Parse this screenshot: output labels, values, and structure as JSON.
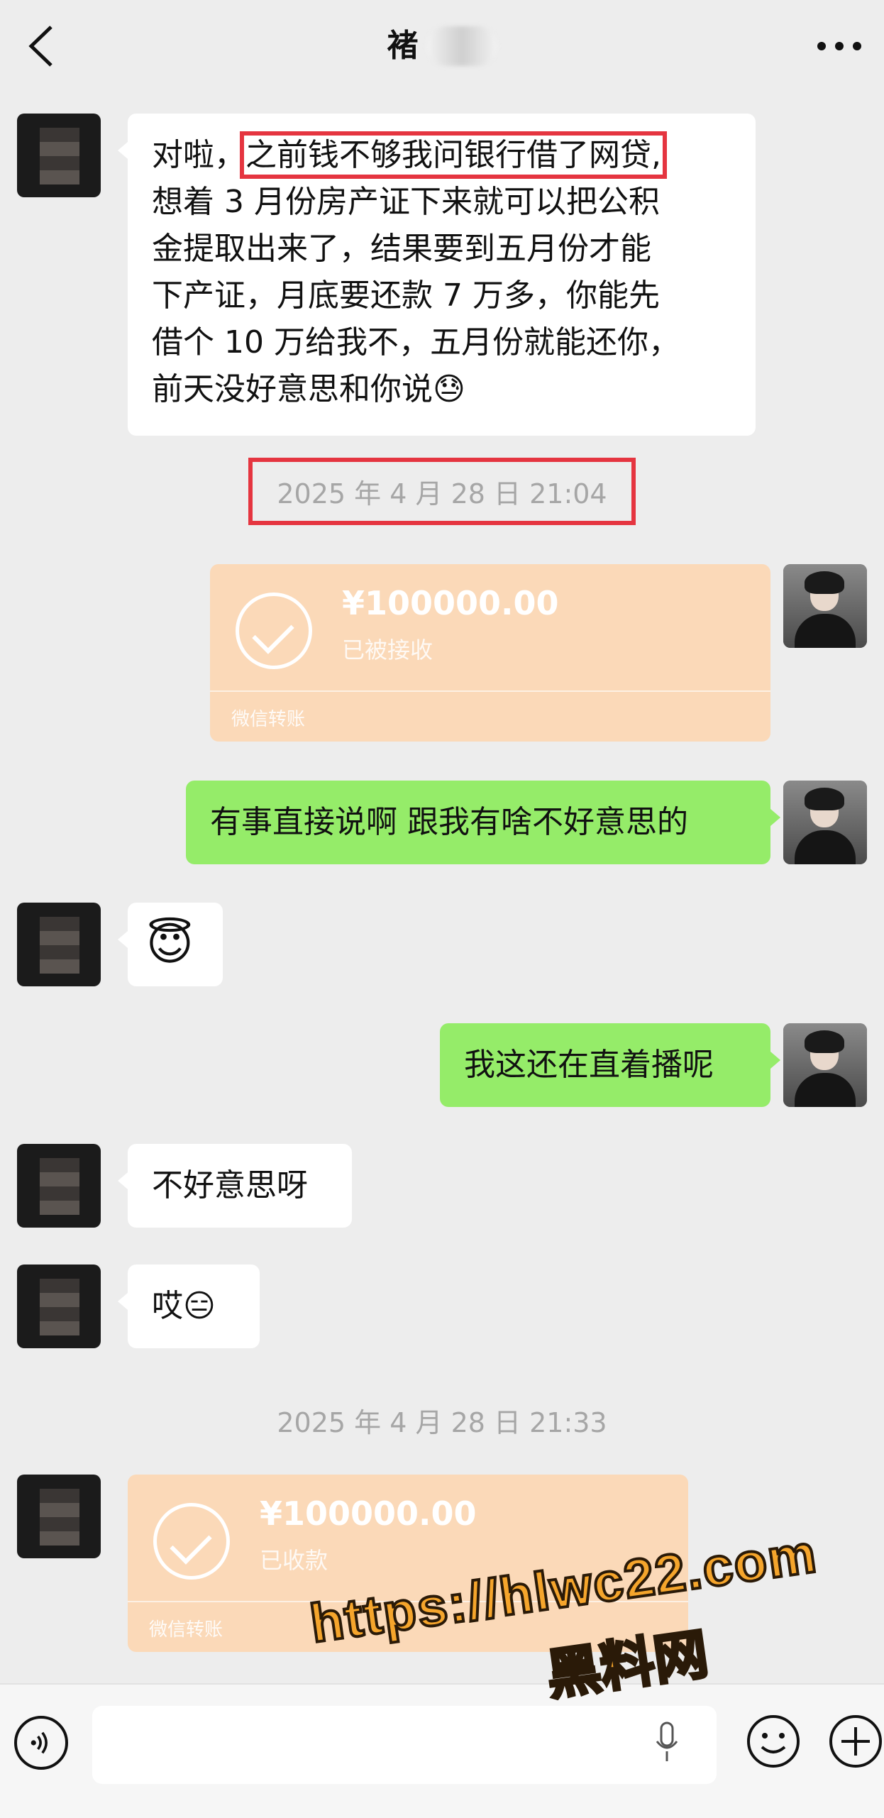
{
  "header": {
    "title": "褚",
    "back_icon": "chevron-left-icon",
    "more_icon": "more-dots-icon"
  },
  "messages": {
    "m1": {
      "lead": "对啦，",
      "highlight": "之前钱不够我问银行借了网贷,",
      "line2": "想着 3 月份房产证下来就可以把公积",
      "line3": "金提取出来了，结果要到五月份才能",
      "line4": "下产证，月底要还款 7 万多，你能先",
      "line5": "借个 10 万给我不，五月份就能还你，",
      "line6": "前天没好意思和你说",
      "emoji": "😓"
    },
    "ts1": "2025 年 4 月 28 日  21:04",
    "transfer1": {
      "amount": "¥100000.00",
      "status": "已被接收",
      "footer": "微信转账"
    },
    "m2": "有事直接说啊 跟我有啥不好意思的",
    "m3_emoji": "😇",
    "m4": "我这还在直着播呢",
    "m5": "不好意思呀",
    "m6": {
      "text": "哎",
      "emoji": "😑"
    },
    "ts2": "2025 年 4 月 28 日  21:33",
    "transfer2": {
      "amount": "¥100000.00",
      "status": "已收款",
      "footer": "微信转账"
    }
  },
  "input_bar": {
    "voice_icon": "voice-icon",
    "mic_icon": "microphone-icon",
    "emoji_icon": "emoji-icon",
    "plus_icon": "plus-icon"
  },
  "watermark": {
    "url": "https://hlwc22.com",
    "site": "黑料网"
  },
  "colors": {
    "background": "#ededed",
    "green_bubble": "#95ec69",
    "transfer_bg": "#fbd9b8",
    "highlight_red": "#e53540"
  }
}
